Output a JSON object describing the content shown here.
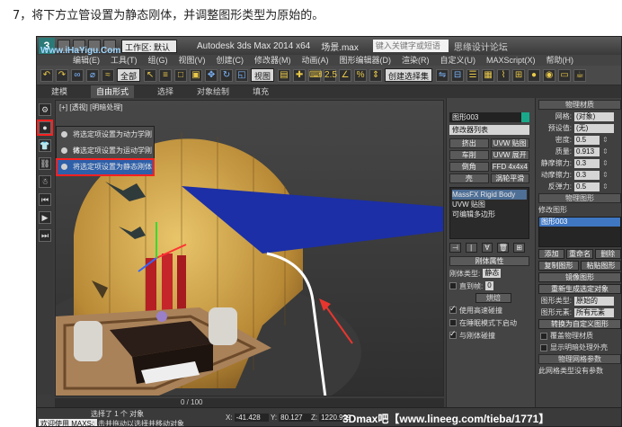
{
  "caption": "7，将下方立管设置为静态刚体，并调整图形类型为原始的。",
  "watermarks": {
    "top_left": "Www.iHaYigu.Com",
    "top_right": "思缘设计论坛 WWW.MISSYUAN.COM",
    "bottom": "3Dmax吧【www.lineeg.com/tieba/1771】"
  },
  "titlebar": {
    "logo": "3",
    "workspace": "工作区: 默认",
    "app_title": "Autodesk 3ds Max 2014 x64",
    "scene": "场景.max",
    "search_placeholder": "键入关键字或短语",
    "right_text": "思缘设计论坛"
  },
  "menu": [
    "编辑(E)",
    "工具(T)",
    "组(G)",
    "视图(V)",
    "创建(C)",
    "修改器(M)",
    "动画(A)",
    "图形编辑器(D)",
    "渲染(R)",
    "自定义(U)",
    "MAXScript(X)",
    "帮助(H)"
  ],
  "toolbar": {
    "filter": "全部",
    "view": "视图",
    "selset": "创建选择集",
    "num": "2.5"
  },
  "ribbon": [
    "建模",
    "自由形式",
    "选择",
    "对象绘制",
    "填充"
  ],
  "viewport": {
    "label": "[+] [透视] [明暗处理]"
  },
  "popup": {
    "items": [
      "将选定项设置为动力学刚体",
      "将选定项设置为运动学刚体",
      "将选定项设置为静态刚体"
    ]
  },
  "status": {
    "maxscript": "欢迎使用 MAXSc",
    "line1": "选择了 1 个 对象",
    "line2": "单击并拖动以选择并移动对象",
    "x_label": "X:",
    "x": "-41.428",
    "y_label": "Y:",
    "y": "80.127",
    "z_label": "Z:",
    "z": "1220.929",
    "grid": "栅格 = 10.0"
  },
  "timeline": "0 / 100",
  "cmd": {
    "object_name": "图形003",
    "modifier_list": "修改器列表",
    "buttons": [
      "挤出",
      "UVW 贴图",
      "车削",
      "UVW 展开",
      "倒角",
      "FFD 4x4x4",
      "壳",
      "涡轮平滑"
    ],
    "stack": [
      "MassFX Rigid Body",
      "UVW 贴图",
      "可编辑多边形"
    ],
    "rigid_header": "刚体属性",
    "rigid_type_label": "刚体类型:",
    "rigid_type": "静态",
    "until_frame": "直到帧:",
    "until_frame_value": "0",
    "bake": "烘焙",
    "chk_high_speed": "使用高速碰撞",
    "chk_sleep": "在睡眠模式下启动",
    "chk_collide": "与刚体碰撞"
  },
  "phys": {
    "header": "物理材质",
    "preset_label": "网格:",
    "preset": "(对象)",
    "preset2_label": "预设值:",
    "preset2": "(无)",
    "density_label": "密度:",
    "density": "0.5",
    "mass_label": "质量:",
    "mass": "0.913",
    "static_fric_label": "静摩擦力:",
    "static_fric": "0.3",
    "dyn_fric_label": "动摩擦力:",
    "dyn_fric": "0.3",
    "bounce_label": "反弹力:",
    "bounce": "0.5",
    "shape_header": "物理图形",
    "modify_shape": "修改图形",
    "shape_item": "图形003",
    "add": "添加",
    "rename": "重命名",
    "delete": "删除",
    "copy": "复制图形",
    "paste": "粘贴图形",
    "mirror": "镜像图形",
    "regen": "重新生成选定对象",
    "shape_type_label": "图形类型:",
    "shape_type": "原始的",
    "shape_elem_label": "图形元素:",
    "shape_elem": "所有元素",
    "convert": "转换为自定义图形",
    "override": "覆盖物理材质",
    "show_hull": "显示明暗处理外壳",
    "mesh_params": "物理网格参数",
    "mesh_note": "此网格类型没有参数"
  }
}
